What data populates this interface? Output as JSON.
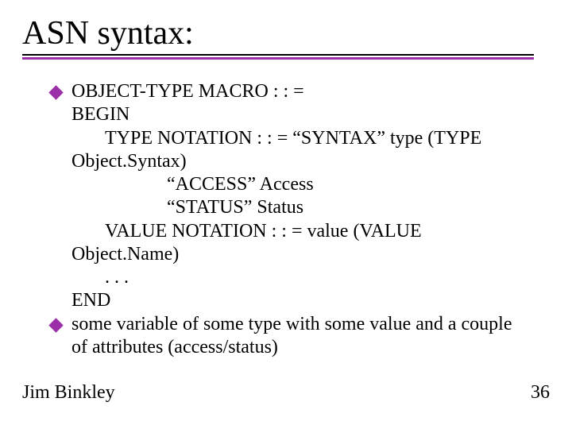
{
  "title": "ASN syntax:",
  "bullets": [
    {
      "lines": [
        {
          "text": "OBJECT-TYPE MACRO : : =",
          "indent": 0
        },
        {
          "text": "BEGIN",
          "indent": 0
        },
        {
          "text": "TYPE NOTATION : : = “SYNTAX” type (TYPE",
          "indent": 1
        },
        {
          "text": "Object.Syntax)",
          "indent": 0
        },
        {
          "text": "“ACCESS” Access",
          "indent": 2
        },
        {
          "text": "“STATUS” Status",
          "indent": 2
        },
        {
          "text": "VALUE NOTATION : : = value (VALUE",
          "indent": 1
        },
        {
          "text": "Object.Name)",
          "indent": 0
        },
        {
          "text": ". . .",
          "indent": 1
        },
        {
          "text": "END",
          "indent": 0
        }
      ]
    },
    {
      "lines": [
        {
          "text": "some variable of some type with some value and a couple",
          "indent": 0
        },
        {
          "text": "of attributes (access/status)",
          "indent": 0
        }
      ]
    }
  ],
  "footer": {
    "author": "Jim Binkley",
    "page": "36"
  }
}
